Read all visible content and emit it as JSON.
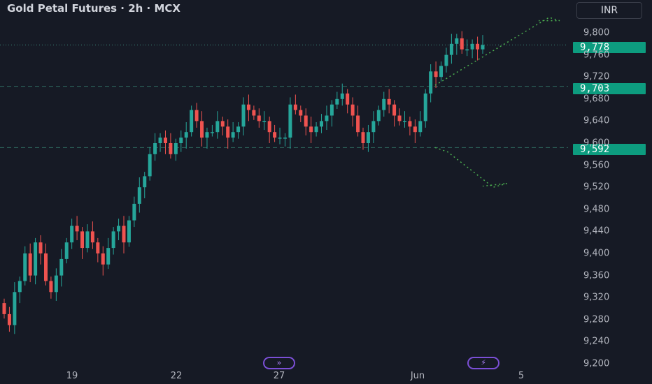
{
  "header": {
    "title": "Gold Petal Futures · 2h · MCX",
    "currency": "INR"
  },
  "price_tags": {
    "last": "9,778",
    "upper": "9,703",
    "lower": "9,592"
  },
  "markers": {
    "left_icon": "fast-forward-icon",
    "right_icon": "lightning-icon"
  },
  "colors": {
    "background": "#161a25",
    "up": "#26a69a",
    "down": "#ef5350",
    "tag": "#0d9c7f",
    "grid_dash": "#2f6b60",
    "projection": "#4caf50"
  },
  "chart_data": {
    "type": "candlestick",
    "title": "Gold Petal Futures · 2h · MCX",
    "ylim": [
      9200,
      9820
    ],
    "y_ticks": [
      "9,800",
      "9,760",
      "9,720",
      "9,680",
      "9,640",
      "9,600",
      "9,560",
      "9,520",
      "9,480",
      "9,440",
      "9,400",
      "9,360",
      "9,320",
      "9,280",
      "9,240",
      "9,200"
    ],
    "x_ticks": [
      "19",
      "22",
      "27",
      "Jun",
      "5"
    ],
    "horizontal_lines": [
      9778,
      9703,
      9592
    ],
    "last_price": 9778,
    "closes": [
      9290,
      9270,
      9330,
      9350,
      9400,
      9360,
      9420,
      9400,
      9350,
      9330,
      9360,
      9390,
      9420,
      9450,
      9440,
      9410,
      9440,
      9420,
      9400,
      9380,
      9410,
      9440,
      9450,
      9420,
      9460,
      9490,
      9520,
      9540,
      9580,
      9600,
      9610,
      9600,
      9580,
      9600,
      9610,
      9620,
      9660,
      9640,
      9610,
      9620,
      9620,
      9640,
      9630,
      9610,
      9620,
      9630,
      9670,
      9660,
      9650,
      9640,
      9640,
      9620,
      9610,
      9610,
      9610,
      9670,
      9660,
      9650,
      9630,
      9620,
      9630,
      9640,
      9650,
      9670,
      9680,
      9690,
      9670,
      9650,
      9620,
      9600,
      9620,
      9640,
      9660,
      9680,
      9670,
      9650,
      9640,
      9640,
      9630,
      9620,
      9640,
      9690,
      9730,
      9720,
      9740,
      9760,
      9780,
      9790,
      9770,
      9770,
      9780,
      9770,
      9778
    ],
    "projection": {
      "upper_end": 9830,
      "lower_end": 9520
    }
  }
}
